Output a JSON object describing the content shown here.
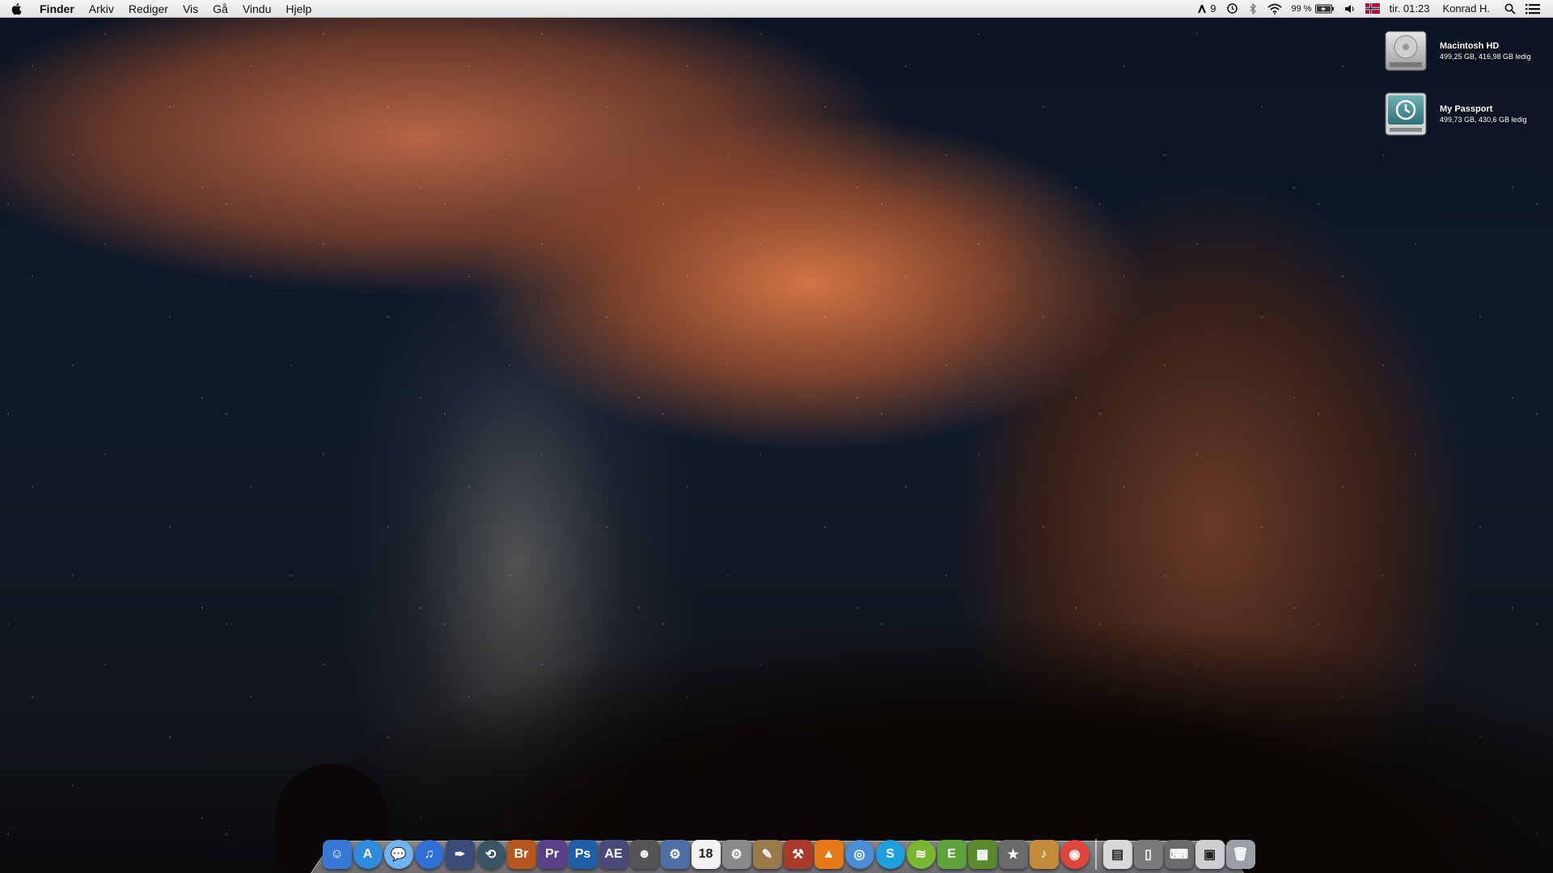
{
  "menubar": {
    "apple_icon": "apple-logo",
    "app_name": "Finder",
    "menus": [
      "Arkiv",
      "Rediger",
      "Vis",
      "Gå",
      "Vindu",
      "Hjelp"
    ],
    "status": {
      "adobe_updates": "9",
      "battery_percent": "99 %",
      "flag_icon": "norway-flag-icon",
      "clock": "tir. 01:23",
      "user": "Konrad H."
    }
  },
  "desktop": {
    "volumes": [
      {
        "name": "Macintosh HD",
        "info": "499,25 GB, 416,98 GB ledig",
        "icon": "hard-drive-icon"
      },
      {
        "name": "My Passport",
        "info": "499,73 GB, 430,6 GB ledig",
        "icon": "time-machine-drive-icon"
      }
    ]
  },
  "dock": {
    "apps": [
      {
        "name": "finder",
        "glyph": "☺",
        "color": "#3a78d8"
      },
      {
        "name": "app-store",
        "glyph": "A",
        "color": "#2f8be0"
      },
      {
        "name": "messages",
        "glyph": "💬",
        "color": "#6fb4f0"
      },
      {
        "name": "itunes",
        "glyph": "♫",
        "color": "#2f6fd6"
      },
      {
        "name": "pixelmator",
        "glyph": "✒",
        "color": "#3b4b7a"
      },
      {
        "name": "time-machine",
        "glyph": "⟲",
        "color": "#3b5566"
      },
      {
        "name": "bridge",
        "glyph": "Br",
        "color": "#b5561e"
      },
      {
        "name": "premiere",
        "glyph": "Pr",
        "color": "#5a3f8a"
      },
      {
        "name": "photoshop",
        "glyph": "Ps",
        "color": "#1f5fa8"
      },
      {
        "name": "after-effects",
        "glyph": "AE",
        "color": "#4a4a7a"
      },
      {
        "name": "steam-avatar",
        "glyph": "☻",
        "color": "#555"
      },
      {
        "name": "automator",
        "glyph": "⚙",
        "color": "#4e6fa5"
      },
      {
        "name": "calendar",
        "glyph": "18",
        "color": "#f2f2f2"
      },
      {
        "name": "system-preferences",
        "glyph": "⚙",
        "color": "#8a8a8a"
      },
      {
        "name": "script-editor",
        "glyph": "✎",
        "color": "#9a7a4a"
      },
      {
        "name": "utility",
        "glyph": "⚒",
        "color": "#aa3a2a"
      },
      {
        "name": "vlc",
        "glyph": "▲",
        "color": "#e77a16"
      },
      {
        "name": "safari",
        "glyph": "◎",
        "color": "#4a8ed8"
      },
      {
        "name": "skype",
        "glyph": "S",
        "color": "#1ea0e0"
      },
      {
        "name": "spotify",
        "glyph": "≋",
        "color": "#7ab630"
      },
      {
        "name": "evernote",
        "glyph": "E",
        "color": "#5da23a"
      },
      {
        "name": "minecraft",
        "glyph": "▦",
        "color": "#5b8a2e"
      },
      {
        "name": "imovie",
        "glyph": "★",
        "color": "#6a6a6a"
      },
      {
        "name": "garageband",
        "glyph": "♪",
        "color": "#c28a3a"
      },
      {
        "name": "chrome",
        "glyph": "◉",
        "color": "#e0443a"
      }
    ],
    "stacks": [
      {
        "name": "documents-stack",
        "glyph": "▤",
        "color": "#d8d8d8"
      },
      {
        "name": "device-stack",
        "glyph": "▯",
        "color": "#7a7a7a"
      },
      {
        "name": "keyboard-stack",
        "glyph": "⌨",
        "color": "#6a6a6a"
      },
      {
        "name": "downloads-stack",
        "glyph": "▣",
        "color": "#cfcfcf"
      },
      {
        "name": "trash",
        "glyph": "🗑",
        "color": "#9aa0a6"
      }
    ]
  }
}
